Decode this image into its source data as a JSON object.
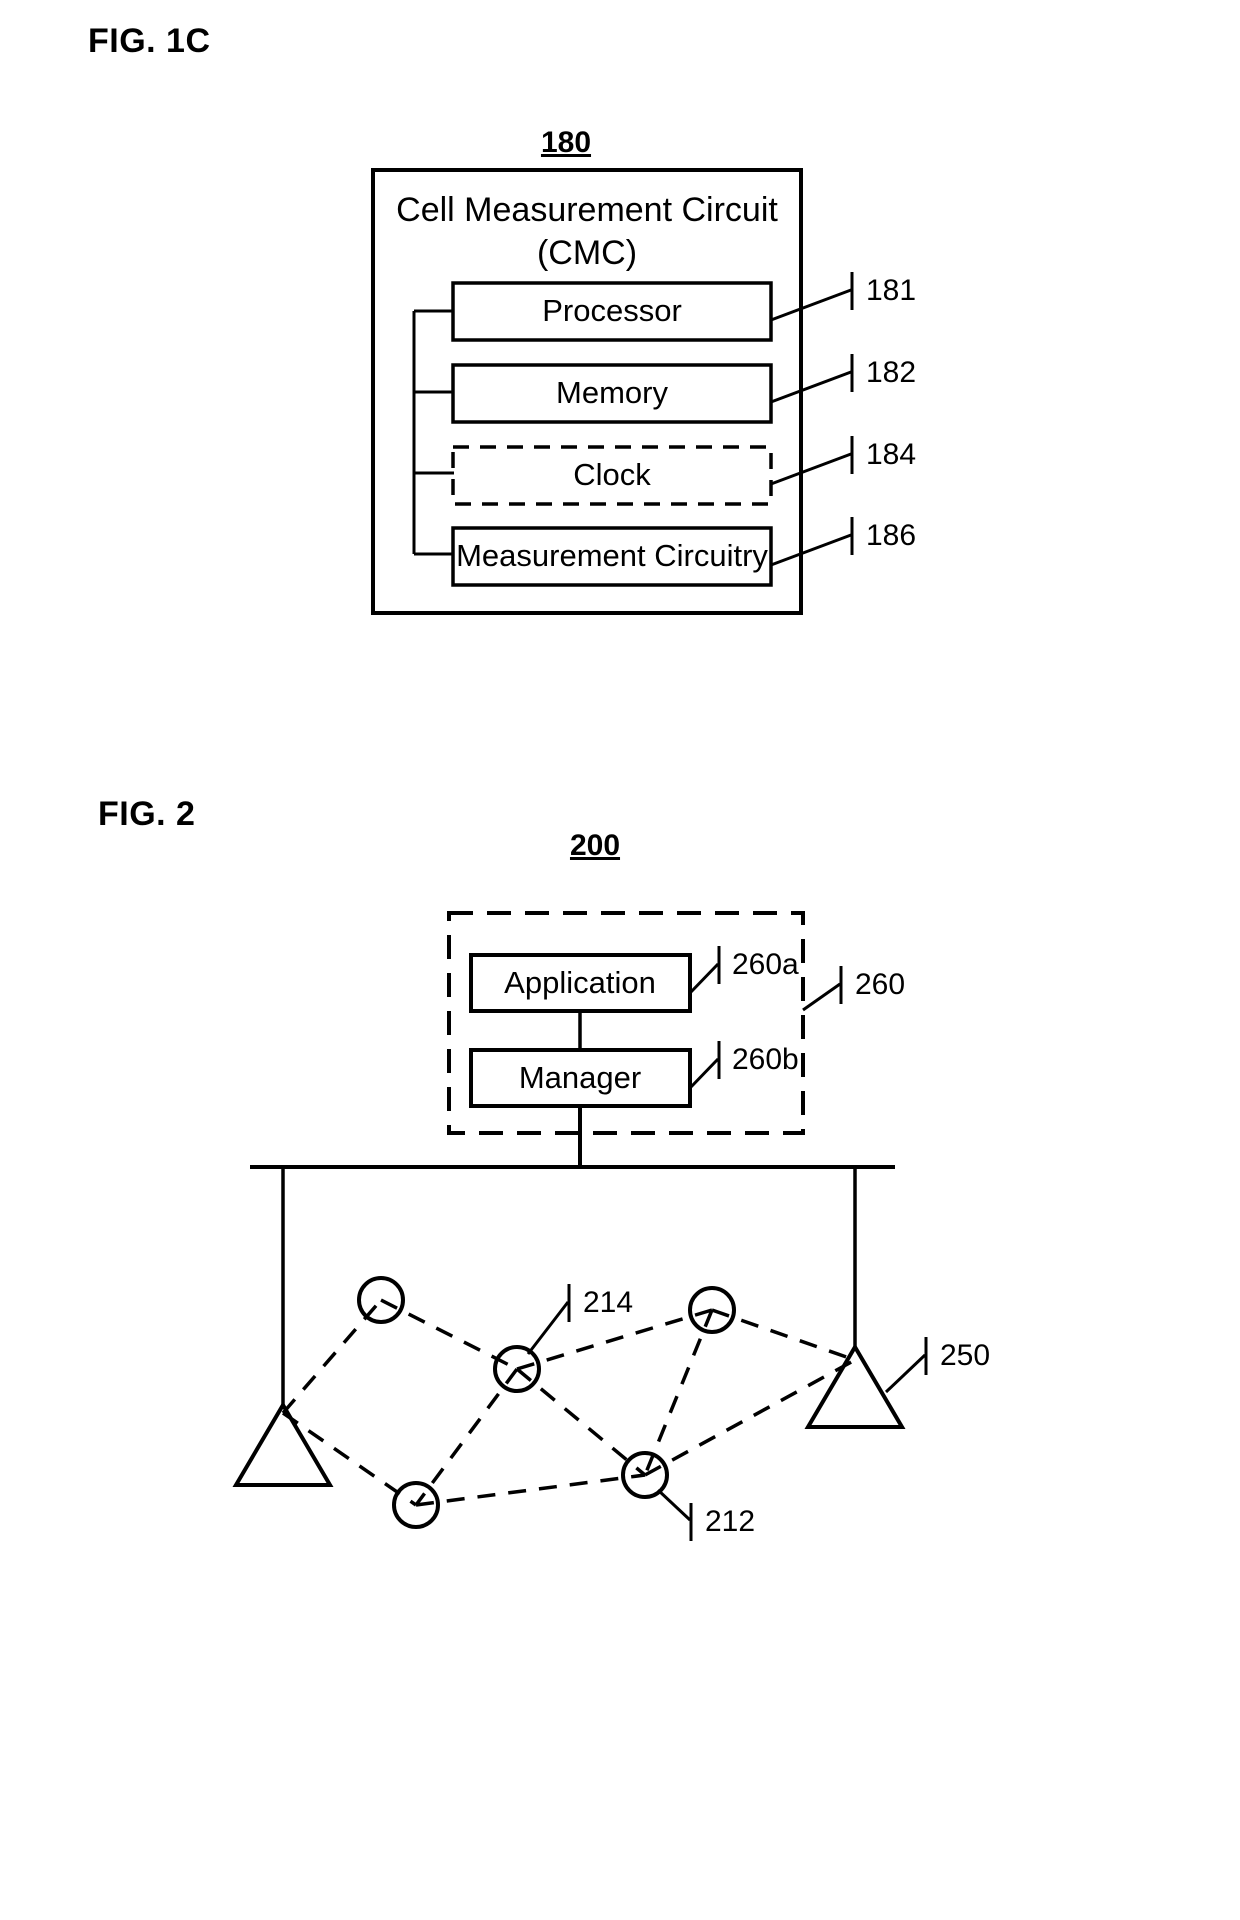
{
  "document": {
    "type": "patent-figure-sheet",
    "background_color": "#ffffff",
    "line_color": "#000000"
  },
  "figures": [
    {
      "id": "fig-1c",
      "label": "FIG. 1C",
      "ref_number": "180",
      "container": {
        "title_line1": "Cell Measurement Circuit",
        "title_line2": "(CMC)",
        "border_style": "solid"
      },
      "blocks": [
        {
          "label": "Processor",
          "ref": "181",
          "border_style": "solid"
        },
        {
          "label": "Memory",
          "ref": "182",
          "border_style": "solid"
        },
        {
          "label": "Clock",
          "ref": "184",
          "border_style": "dashed"
        },
        {
          "label": "Measurement Circuitry",
          "ref": "186",
          "border_style": "solid"
        }
      ]
    },
    {
      "id": "fig-2",
      "label": "FIG. 2",
      "ref_number": "200",
      "dashed_group": {
        "ref": "260",
        "blocks": [
          {
            "label": "Application",
            "ref": "260a",
            "border_style": "solid"
          },
          {
            "label": "Manager",
            "ref": "260b",
            "border_style": "solid"
          }
        ]
      },
      "network": {
        "bus_ref": "250",
        "node_refs": [
          {
            "ref": "214",
            "shape": "circle"
          },
          {
            "ref": "212",
            "shape": "circle"
          }
        ],
        "circle_node_count": 5,
        "triangle_node_count": 2,
        "link_style": "dashed"
      }
    }
  ]
}
